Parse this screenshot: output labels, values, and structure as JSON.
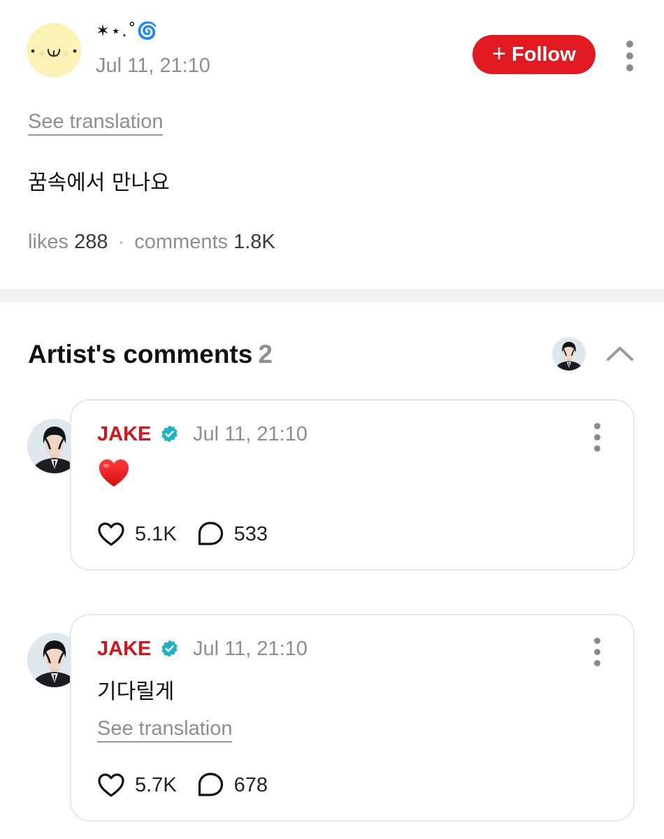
{
  "post": {
    "author_name": "✶⋆.˚🌀",
    "timestamp": "Jul 11, 21:10",
    "follow_label": "Follow",
    "see_translation": "See translation",
    "text": "꿈속에서 만나요",
    "likes_label": "likes",
    "likes_count": "288",
    "separator": "·",
    "comments_label": "comments",
    "comments_count": "1.8K"
  },
  "artist_comments": {
    "title": "Artist's comments",
    "count": "2",
    "items": [
      {
        "author": "JAKE",
        "verified": true,
        "timestamp": "Jul 11, 21:10",
        "content_emoji": "heart-emoji",
        "likes": "5.1K",
        "replies": "533"
      },
      {
        "author": "JAKE",
        "verified": true,
        "timestamp": "Jul 11, 21:10",
        "text": "기다릴게",
        "see_translation": "See translation",
        "likes": "5.7K",
        "replies": "678"
      }
    ]
  },
  "colors": {
    "accent_red": "#e11a22",
    "artist_name_red": "#d4151d",
    "verified_teal": "#19b4c8",
    "muted_text": "#8e8e8e",
    "user_avatar_bg": "#fbf3b5"
  },
  "icons": [
    "kebab-menu-icon",
    "plus-icon",
    "chevron-up-icon",
    "verified-badge-icon",
    "heart-outline-icon",
    "comment-bubble-icon",
    "heart-emoji"
  ]
}
